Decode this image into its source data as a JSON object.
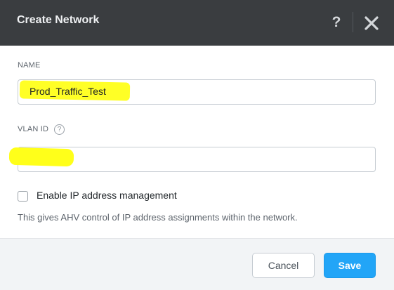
{
  "dialog": {
    "title": "Create Network",
    "help_glyph": "?",
    "close_icon": "close-icon"
  },
  "form": {
    "name_label": "NAME",
    "name_value": "Prod_Traffic_Test",
    "vlan_label": "VLAN ID",
    "vlan_info_glyph": "?",
    "vlan_value": "",
    "ip_mgmt_label": "Enable IP address management",
    "ip_mgmt_checked": false,
    "ip_mgmt_hint": "This gives AHV control of IP address assignments within the network."
  },
  "footer": {
    "cancel_label": "Cancel",
    "save_label": "Save"
  },
  "colors": {
    "header_bg": "#3a3d40",
    "accent": "#22a5f7",
    "highlight": "#ffff1a"
  }
}
